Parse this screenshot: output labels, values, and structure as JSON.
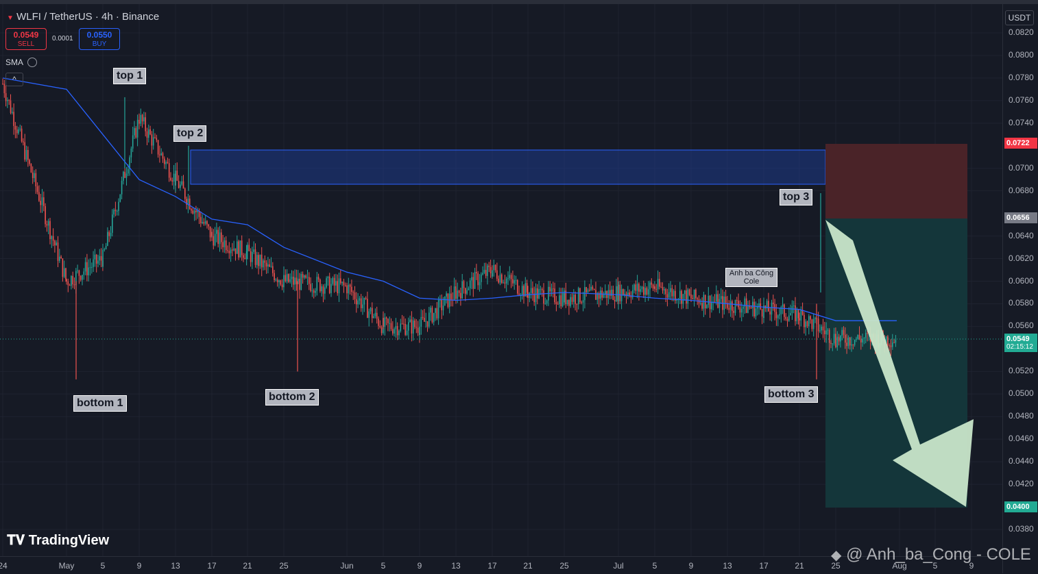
{
  "header": {
    "symbol_title": "WLFI / TetherUS · 4h · Binance",
    "sell_price": "0.0549",
    "sell_label": "SELL",
    "spread": "0.0001",
    "buy_price": "0.0550",
    "buy_label": "BUY",
    "indicator_name": "SMA",
    "collapse_symbol": "^"
  },
  "price_scale": {
    "currency": "USDT",
    "ticks": [
      "0.0820",
      "0.0800",
      "0.0780",
      "0.0760",
      "0.0740",
      "0.0700",
      "0.0680",
      "0.0640",
      "0.0620",
      "0.0600",
      "0.0580",
      "0.0560",
      "0.0520",
      "0.0500",
      "0.0480",
      "0.0460",
      "0.0440",
      "0.0420",
      "0.0380"
    ],
    "tags": {
      "stop": {
        "value": "0.0722",
        "color": "#f23645"
      },
      "entry": {
        "value": "0.0656",
        "color": "#787b86"
      },
      "current": {
        "value": "0.0549",
        "countdown": "02:15:12",
        "color": "#22ab94"
      },
      "target": {
        "value": "0.0400",
        "color": "#22ab94"
      }
    }
  },
  "time_scale": {
    "labels": [
      "24",
      "May",
      "5",
      "9",
      "13",
      "17",
      "21",
      "25",
      "Jun",
      "5",
      "9",
      "13",
      "17",
      "21",
      "25",
      "Jul",
      "5",
      "9",
      "13",
      "17",
      "21",
      "25",
      "Aug",
      "5",
      "9"
    ]
  },
  "annotations": {
    "top1": "top 1",
    "top2": "top 2",
    "top3": "top 3",
    "bottom1": "bottom 1",
    "bottom2": "bottom 2",
    "bottom3": "bottom 3",
    "author_line1": "Anh ba Công",
    "author_line2": "Cole"
  },
  "branding": {
    "tradingview": "TradingView",
    "watermark": "@ Anh_ba_Cong - COLE"
  },
  "colors": {
    "background": "#161a25",
    "up_candle": "#26a69a",
    "down_candle": "#ef5350",
    "sma": "#2962ff",
    "resistance_zone": "#1e3a8a",
    "stop_zone": "#4a2328",
    "profit_zone": "#14363a",
    "arrow": "#c8e6c9"
  },
  "chart_data": {
    "type": "line",
    "title": "WLFI / TetherUS · 4h · Binance",
    "ylim": [
      0.036,
      0.083
    ],
    "series": [
      {
        "name": "WLFI / TetherUS",
        "x": [
          "24",
          "May",
          "5",
          "9",
          "13",
          "17",
          "21",
          "25",
          "Jun",
          "5",
          "9",
          "13",
          "17",
          "21",
          "25",
          "Jul",
          "5",
          "9",
          "13",
          "17",
          "21",
          "25"
        ],
        "values": [
          0.0775,
          0.06,
          0.062,
          0.0745,
          0.069,
          0.064,
          0.0625,
          0.06,
          0.0595,
          0.056,
          0.056,
          0.059,
          0.061,
          0.059,
          0.0585,
          0.059,
          0.0595,
          0.0585,
          0.058,
          0.0575,
          0.057,
          0.0549
        ]
      },
      {
        "name": "SMA",
        "x": [
          "24",
          "May",
          "5",
          "9",
          "13",
          "17",
          "21",
          "25",
          "Jun",
          "5",
          "9",
          "13",
          "17",
          "21",
          "25",
          "Jul",
          "5",
          "9",
          "13",
          "17",
          "21",
          "25"
        ],
        "values": [
          0.078,
          0.077,
          0.073,
          0.069,
          0.0675,
          0.0655,
          0.065,
          0.063,
          0.0608,
          0.06,
          0.0585,
          0.0583,
          0.0585,
          0.0588,
          0.059,
          0.0588,
          0.0585,
          0.0583,
          0.058,
          0.0577,
          0.0575,
          0.0565
        ]
      }
    ]
  }
}
